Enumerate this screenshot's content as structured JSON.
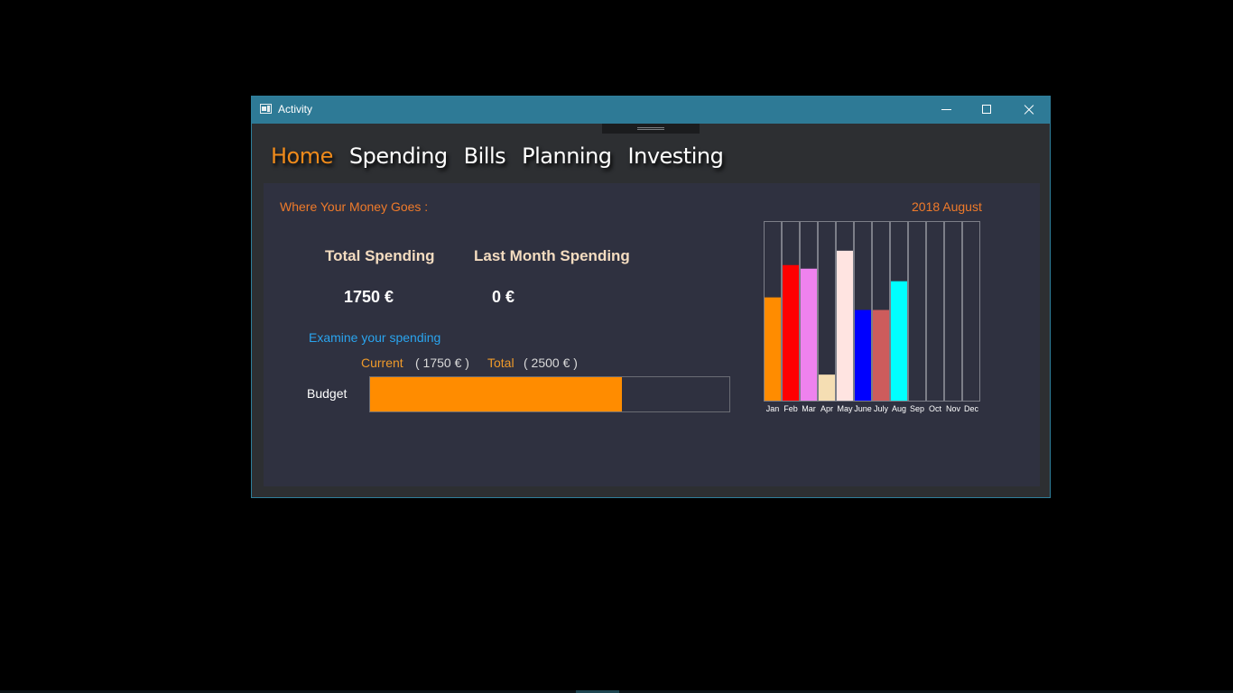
{
  "window": {
    "title": "Activity"
  },
  "nav": {
    "items": [
      {
        "label": "Home",
        "active": true
      },
      {
        "label": "Spending",
        "active": false
      },
      {
        "label": "Bills",
        "active": false
      },
      {
        "label": "Planning",
        "active": false
      },
      {
        "label": "Investing",
        "active": false
      }
    ]
  },
  "home": {
    "heading": "Where Your Money Goes :",
    "date": "2018 August",
    "total_spending_label": "Total Spending",
    "total_spending_value": "1750 €",
    "last_month_label": "Last Month Spending",
    "last_month_value": "0 €",
    "examine_link": "Examine your spending",
    "budget": {
      "current_label": "Current",
      "current_value": "( 1750 € )",
      "total_label": "Total",
      "total_value": "( 2500 € )",
      "label": "Budget",
      "fill_fraction": 0.7,
      "fill_color": "#ff8c00"
    }
  },
  "chart_data": {
    "type": "bar",
    "categories": [
      "Jan",
      "Feb",
      "Mar",
      "Apr",
      "May",
      "June",
      "July",
      "Aug",
      "Sep",
      "Oct",
      "Nov",
      "Dec"
    ],
    "values": [
      0.58,
      0.76,
      0.74,
      0.15,
      0.84,
      0.51,
      0.51,
      0.67,
      0,
      0,
      0,
      0
    ],
    "colors": [
      "#ff8c00",
      "#ff0000",
      "#ee82ee",
      "#f5deb3",
      "#ffe4e1",
      "#0000ff",
      "#cd5c5c",
      "#00ffff",
      "#2f3140",
      "#2f3140",
      "#2f3140",
      "#2f3140"
    ],
    "ylim": [
      0,
      1
    ]
  }
}
